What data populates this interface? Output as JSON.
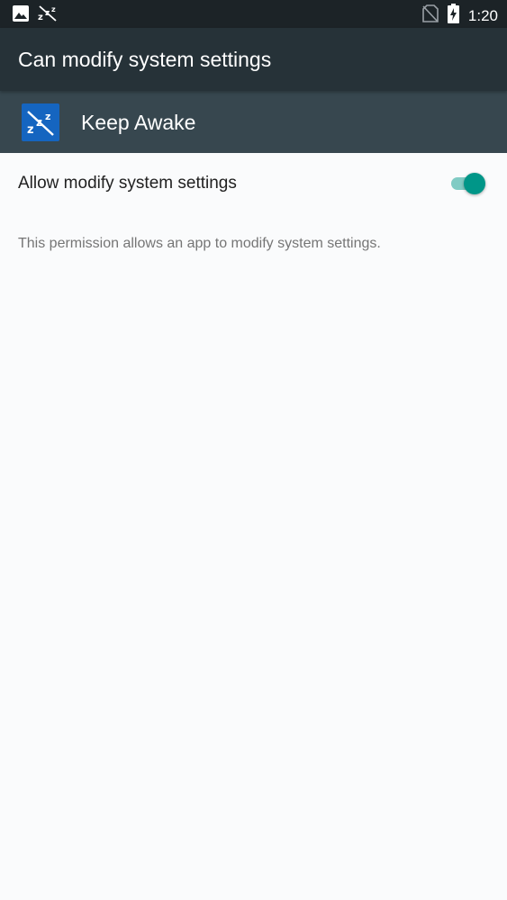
{
  "status_bar": {
    "time": "1:20",
    "icons": [
      "image-icon",
      "keep-awake-icon",
      "no-sim-icon",
      "battery-charging-icon"
    ]
  },
  "toolbar": {
    "title": "Can modify system settings"
  },
  "app": {
    "name": "Keep Awake",
    "icon": "keep-awake-icon",
    "icon_color": "#1565c0"
  },
  "setting": {
    "label": "Allow modify system settings",
    "enabled": true
  },
  "description": "This permission allows an app to modify system settings.",
  "colors": {
    "status_bar": "#1c2327",
    "toolbar": "#263238",
    "app_header": "#37474f",
    "accent": "#009688",
    "background": "#fafbfc"
  }
}
